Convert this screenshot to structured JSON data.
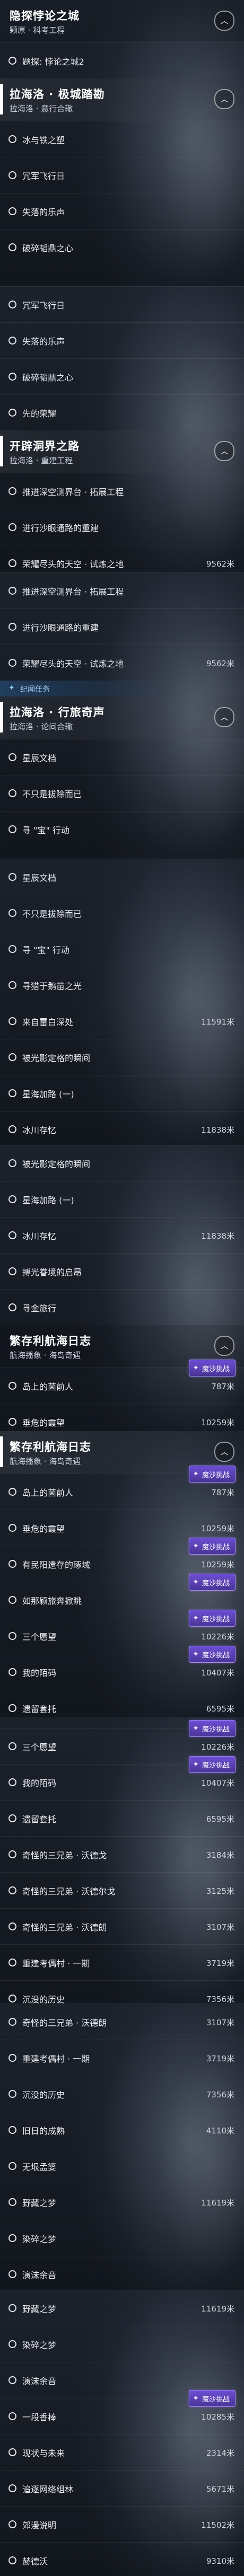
{
  "icons": {
    "collapse": "chevron-up-icon",
    "quest": "quest-circle-icon",
    "badge": "sparkle-icon"
  },
  "colors": {
    "accent_bar": "#ffffff",
    "badge_purple": "#5a3fb8",
    "tag_blue": "#a9d6ff"
  },
  "quest_groups": [
    {
      "title": "隐探悖论之城",
      "subtitle": "颗原 · 科考工程"
    },
    {
      "title": "拉海洛 · 极城踏勘",
      "subtitle": "拉海洛 · 意行合辙"
    },
    {
      "title": "开辟洞界之路",
      "subtitle": "拉海洛 · 重建工程"
    },
    {
      "title": "拉海洛 · 行旅奇声",
      "subtitle": "拉海洛 · 论间合辙"
    },
    {
      "title": "繁存利航海日志",
      "subtitle": "航海播象 · 海岛奇遇"
    },
    {
      "title": "繁存利航海日志",
      "subtitle": "航海播象 · 海岛奇遇"
    }
  ],
  "tag_label": "纪闻任务",
  "badge_label": "魔沙挑战",
  "quests": [
    {
      "label": "题探: 悖论之城2",
      "progress": ""
    },
    {
      "label": "冰与铁之塑",
      "progress": ""
    },
    {
      "label": "冗军飞行日",
      "progress": ""
    },
    {
      "label": "失落的乐声",
      "progress": ""
    },
    {
      "label": "破碎韬鼎之心",
      "progress": ""
    },
    {
      "label": "冗军飞行日",
      "progress": ""
    },
    {
      "label": "失落的乐声",
      "progress": ""
    },
    {
      "label": "破碎韬鼎之心",
      "progress": ""
    },
    {
      "label": "先的荣耀",
      "progress": ""
    },
    {
      "label": "推进深空测界台 · 拓展工程",
      "progress": ""
    },
    {
      "label": "进行沙眼通路的重建",
      "progress": ""
    },
    {
      "label": "荣耀尽头的天空 · 试炼之地",
      "progress": "9562米"
    },
    {
      "label": "推进深空测界台 · 拓展工程",
      "progress": ""
    },
    {
      "label": "进行沙眼通路的重建",
      "progress": ""
    },
    {
      "label": "荣耀尽头的天空 · 试炼之地",
      "progress": "9562米"
    },
    {
      "label": "星辰文档",
      "progress": ""
    },
    {
      "label": "不只是拔除而已",
      "progress": ""
    },
    {
      "label": "寻 \"宝\" 行动",
      "progress": ""
    },
    {
      "label": "星辰文档",
      "progress": ""
    },
    {
      "label": "不只是拔除而已",
      "progress": ""
    },
    {
      "label": "寻 \"宝\" 行动",
      "progress": ""
    },
    {
      "label": "寻猎于鹅苗之光",
      "progress": ""
    },
    {
      "label": "来自雷白深处",
      "progress": "11591米"
    },
    {
      "label": "被光影定格的瞬间",
      "progress": ""
    },
    {
      "label": "星海加路 (一)",
      "progress": ""
    },
    {
      "label": "冰川存忆",
      "progress": "11838米"
    },
    {
      "label": "被光影定格的瞬间",
      "progress": ""
    },
    {
      "label": "星海加路 (一)",
      "progress": ""
    },
    {
      "label": "冰川存忆",
      "progress": "11838米"
    },
    {
      "label": "搏光眷境的启昂",
      "progress": ""
    },
    {
      "label": "寻金旅行",
      "progress": ""
    },
    {
      "label": "岛上的菌前人",
      "progress": "787米"
    },
    {
      "label": "垂危的霞望",
      "progress": "10259米"
    },
    {
      "label": "岛上的菌前人",
      "progress": "787米"
    },
    {
      "label": "垂危的霞望",
      "progress": "10259米"
    },
    {
      "label": "有民阳遗存的琢域",
      "progress": "10259米"
    },
    {
      "label": "如那颖旅奔掀眺",
      "progress": ""
    },
    {
      "label": "三个愿望",
      "progress": "10226米"
    },
    {
      "label": "我的陌码",
      "progress": "10407米"
    },
    {
      "label": "遗留套托",
      "progress": "6595米"
    },
    {
      "label": "三个愿望",
      "progress": "10226米"
    },
    {
      "label": "我的陌码",
      "progress": "10407米"
    },
    {
      "label": "遗留套托",
      "progress": "6595米"
    },
    {
      "label": "奇怪的三兄弟 · 沃德戈",
      "progress": "3184米"
    },
    {
      "label": "奇怪的三兄弟 · 沃德尔戈",
      "progress": "3125米"
    },
    {
      "label": "奇怪的三兄弟 · 沃德朗",
      "progress": "3107米"
    },
    {
      "label": "重建考偶村 · 一期",
      "progress": "3719米"
    },
    {
      "label": "沉没的历史",
      "progress": "7356米"
    },
    {
      "label": "奇怪的三兄弟 · 沃德朗",
      "progress": "3107米"
    },
    {
      "label": "重建考偶村 · 一期",
      "progress": "3719米"
    },
    {
      "label": "沉没的历史",
      "progress": "7356米"
    },
    {
      "label": "旧日的成熟",
      "progress": "4110米"
    },
    {
      "label": "无垠孟婆",
      "progress": ""
    },
    {
      "label": "野藏之梦",
      "progress": "11619米"
    },
    {
      "label": "染碎之梦",
      "progress": ""
    },
    {
      "label": "演沫余音",
      "progress": ""
    },
    {
      "label": "野藏之梦",
      "progress": "11619米"
    },
    {
      "label": "染碎之梦",
      "progress": ""
    },
    {
      "label": "演沫余音",
      "progress": ""
    },
    {
      "label": "一段香棒",
      "progress": "10285米"
    },
    {
      "label": "现状与未来",
      "progress": "2314米"
    },
    {
      "label": "追逐网络组林",
      "progress": "5671米"
    },
    {
      "label": "郊漫说明",
      "progress": "11502米"
    },
    {
      "label": "赫德沃",
      "progress": "9310米"
    }
  ]
}
